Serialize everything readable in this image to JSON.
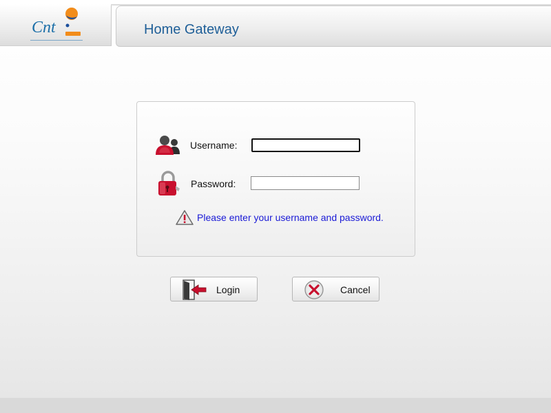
{
  "header": {
    "title": "Home Gateway",
    "logo_icon": "cnt-logo-icon"
  },
  "login_form": {
    "username_label": "Username:",
    "username_value": "",
    "password_label": "Password:",
    "password_value": "",
    "warning_message": "Please enter your username and password.",
    "icons": {
      "username": "users-icon",
      "password": "padlock-icon",
      "warning": "warning-triangle-icon"
    }
  },
  "buttons": {
    "login_label": "Login",
    "cancel_label": "Cancel",
    "login_icon": "door-enter-icon",
    "cancel_icon": "cancel-x-icon"
  },
  "colors": {
    "title": "#1f5f98",
    "warning_text": "#1a1ad6",
    "icon_red": "#c8102e"
  }
}
